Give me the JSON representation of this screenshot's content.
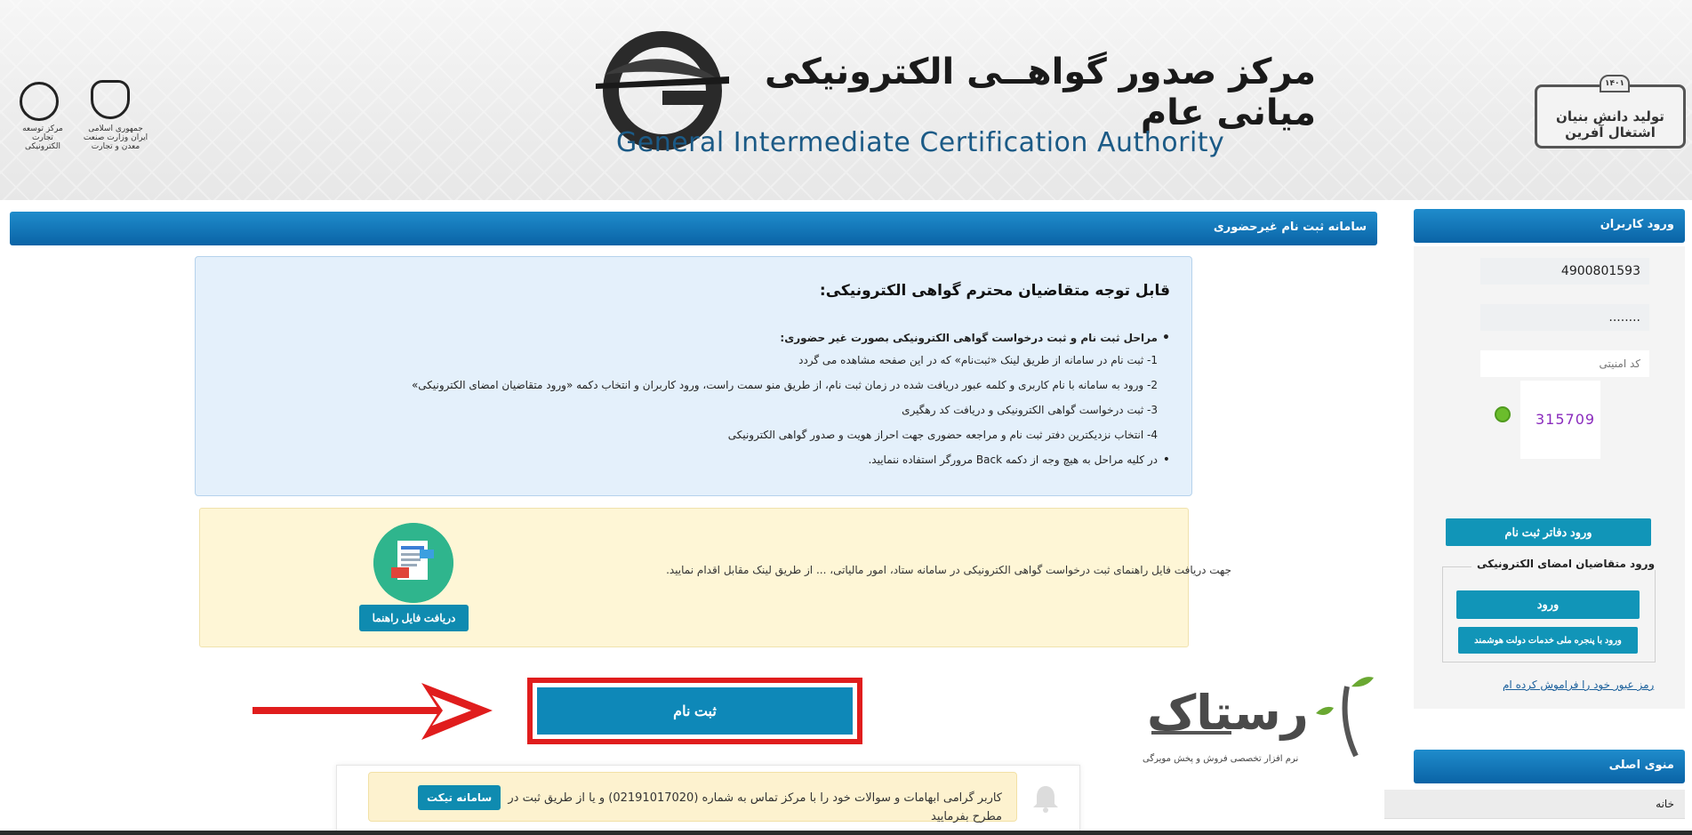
{
  "header": {
    "title_fa": "مرکز صدور گواهــی الکترونیکی میانی عام",
    "title_en": "General Intermediate Certification Authority",
    "seal_left_caption_1": "مرکز توسعه تجارت الکترونیکی",
    "seal_left_caption_2": "جمهوری اسلامی ایران وزارت صنعت معدن و تجارت",
    "stamp_right_text": "تولید دانش بنیان اشتغال آفرین",
    "stamp_right_year": "۱۴۰۱"
  },
  "main": {
    "section_title": "سامانه ثبت نام غیرحضوری",
    "notice": {
      "heading": "قابل توجه متقاضیان محترم گواهی الکترونیکی:",
      "bullet_1": "مراحل ثبت نام و ثبت درخواست گواهی الکترونیکی بصورت غیر حضوری:",
      "steps": [
        "1- ثبت نام در سامانه از طریق لینک «ثبت‌نام» که در این صفحه مشاهده می گردد",
        "2- ورود به سامانه با نام کاربری و کلمه عبور دریافت شده در زمان ثبت نام، از طریق منو سمت راست، ورود کاربران و انتخاب دکمه «ورود متقاضیان امضای الکترونیکی»",
        "3- ثبت درخواست گواهی الکترونیکی و دریافت کد رهگیری",
        "4- انتخاب نزدیکترین دفتر ثبت نام و مراجعه حضوری جهت احراز هویت و صدور گواهی الکترونیکی"
      ],
      "bullet_2": "در کلیه مراحل به هیچ وجه از دکمه Back مرورگر استفاده ننمایید."
    },
    "guide": {
      "text": "جهت دریافت فایل راهنمای ثبت درخواست گواهی الکترونیکی در سامانه ستاد، امور مالیاتی، ... از طریق لینک مقابل اقدام نمایید.",
      "button": "دریافت فایل راهنما",
      "icon": "document-icon"
    },
    "register_button": "ثبت نام",
    "ticket": {
      "text_before": "کاربر گرامی ابهامات و سوالات خود را با مرکز تماس به شماره (02191017020) و یا از طریق ثبت در",
      "button": "سامانه تیکت",
      "text_after": "مطرح بفرمایید"
    }
  },
  "watermark": {
    "name": "رستاک",
    "subtitle": "نرم افزار تخصصی فروش و پخش مویرگی"
  },
  "sidebar": {
    "login_title": "ورود کاربران",
    "username": "4900801593",
    "password": "........",
    "captcha_placeholder": "کد امنیتی",
    "captcha_value": "315709",
    "office_login": "ورود دفاتر ثبت نام",
    "applicants_legend": "ورود متقاضیان امضای الکترونیکی",
    "login_button": "ورود",
    "smart_gov_button": "ورود با پنجره ملی خدمات دولت هوشمند",
    "forgot_password": "رمز عبور خود را فراموش کرده ام",
    "menu_title": "منوی اصلی",
    "menu_items": [
      "خانه"
    ]
  },
  "colors": {
    "bar_blue": "#0a63a6",
    "teal": "#1195b8",
    "highlight_red": "#e01d1d",
    "notice_bg": "#e4f0fb",
    "guide_bg": "#fef6d6"
  }
}
